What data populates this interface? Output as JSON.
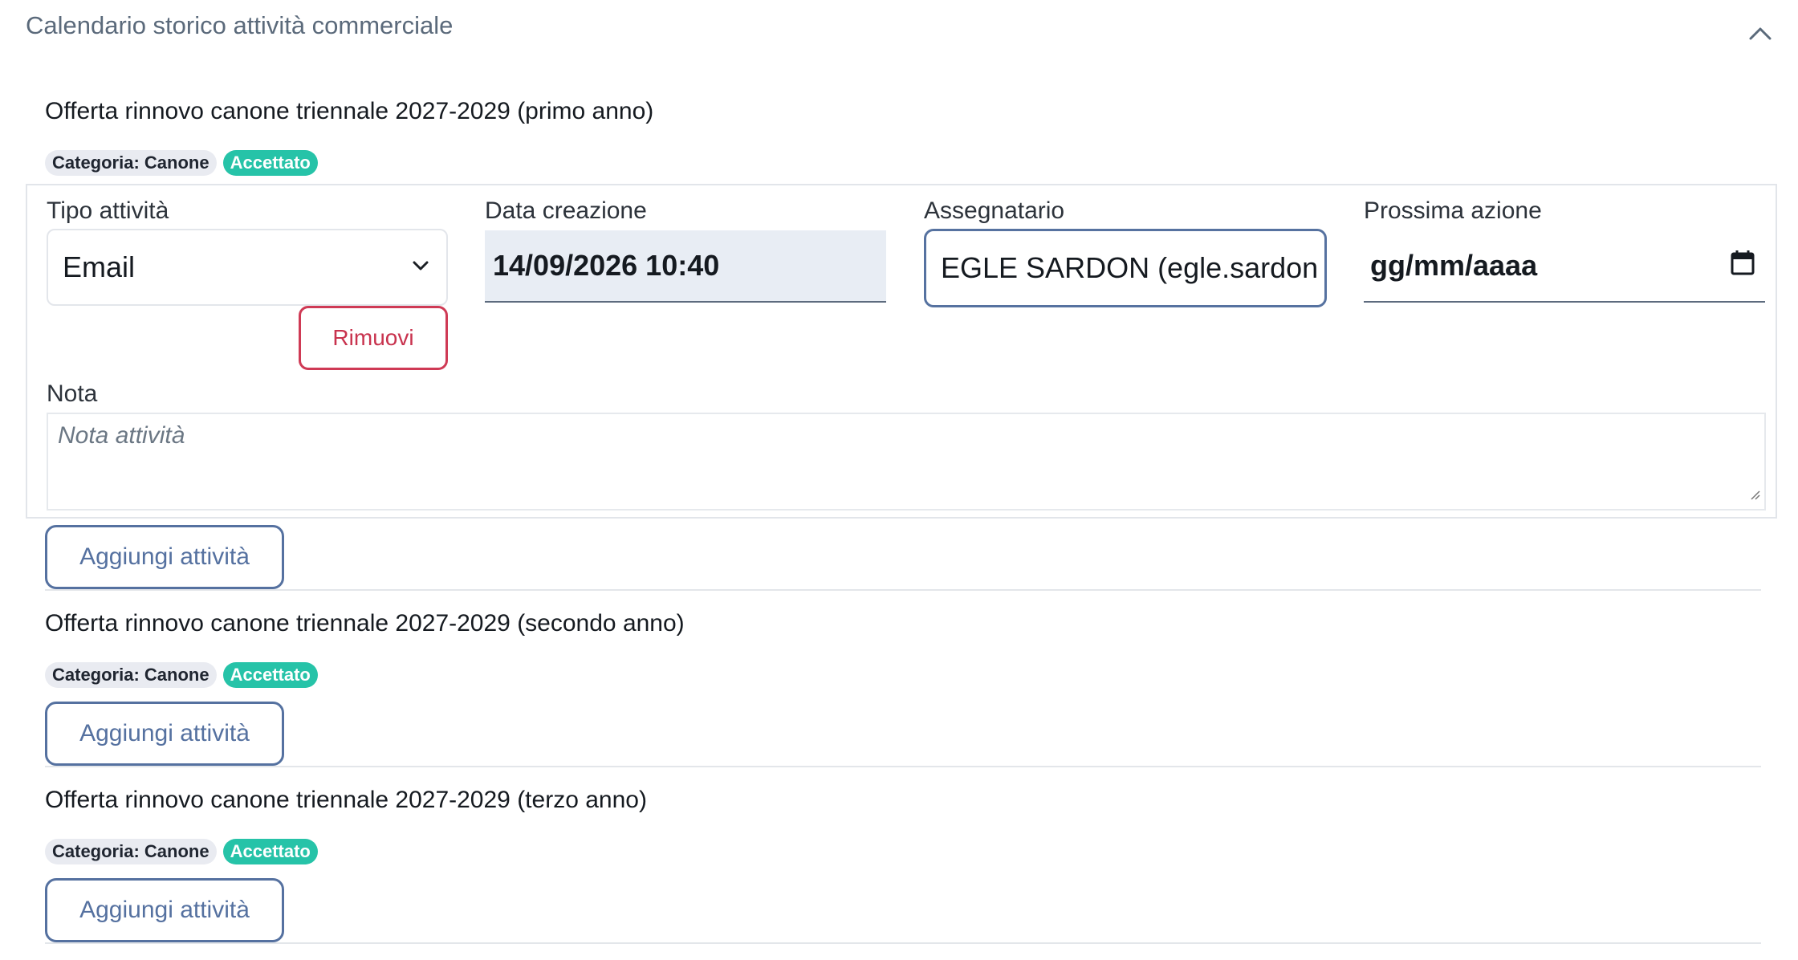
{
  "section": {
    "title": "Calendario storico attività commerciale",
    "collapse_icon": "chevron-up-icon"
  },
  "offers": [
    {
      "title": "Offerta rinnovo canone triennale 2027-2029 (primo anno)",
      "category_badge": "Categoria: Canone",
      "status_badge": "Accettato",
      "activity": {
        "tipo_label": "Tipo attività",
        "tipo_value": "Email",
        "data_label": "Data creazione",
        "data_value": "14/09/2026 10:40",
        "assegnatario_label": "Assegnatario",
        "assegnatario_value": "EGLE SARDON (egle.sardon",
        "prossima_label": "Prossima azione",
        "prossima_placeholder": "gg/mm/aaaa",
        "remove_label": "Rimuovi",
        "nota_label": "Nota",
        "nota_placeholder": "Nota attività"
      },
      "add_label": "Aggiungi attività"
    },
    {
      "title": "Offerta rinnovo canone triennale 2027-2029 (secondo anno)",
      "category_badge": "Categoria: Canone",
      "status_badge": "Accettato",
      "add_label": "Aggiungi attività"
    },
    {
      "title": "Offerta rinnovo canone triennale 2027-2029 (terzo anno)",
      "category_badge": "Categoria: Canone",
      "status_badge": "Accettato",
      "add_label": "Aggiungi attività"
    }
  ],
  "colors": {
    "accent": "#5571a0",
    "success": "#26c3a8",
    "danger": "#cf3a55"
  }
}
